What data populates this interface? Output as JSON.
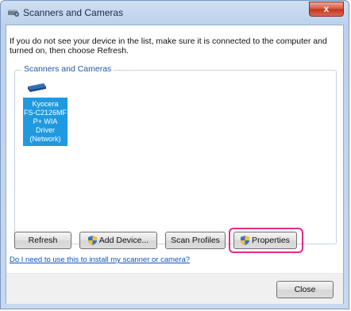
{
  "window": {
    "title": "Scanners and Cameras",
    "close_glyph": "x"
  },
  "instructions": "If you do not see your device in the list, make sure it is connected to the computer and turned on, then choose Refresh.",
  "group": {
    "label": "Scanners and Cameras",
    "devices": [
      {
        "name": "Kyocera FS-C2126MFP+ WIA Driver (Network)",
        "lines": [
          "Kyocera",
          "FS-C2126MF",
          "P+ WIA",
          "Driver",
          "(Network)"
        ],
        "selected": true,
        "icon": "scanner-icon"
      }
    ]
  },
  "buttons": {
    "refresh": "Refresh",
    "add_device": "Add Device...",
    "scan_profiles": "Scan Profiles",
    "properties": "Properties",
    "close": "Close"
  },
  "help_link": "Do I need to use this to install my scanner or camera?",
  "colors": {
    "selection": "#1f9ae0",
    "highlight": "#e3298d",
    "link": "#0a56c4"
  }
}
